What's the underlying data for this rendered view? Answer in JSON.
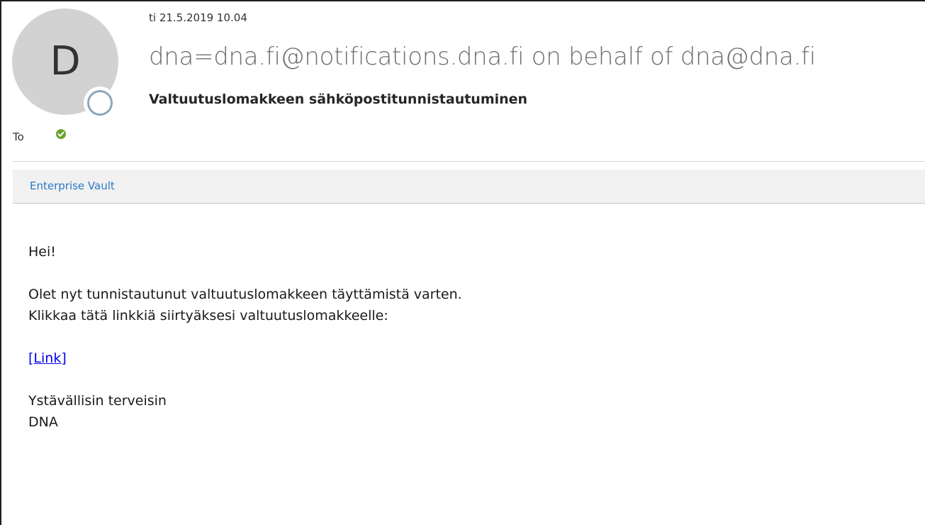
{
  "header": {
    "avatar_initial": "D",
    "date": "ti 21.5.2019 10.04",
    "sender": "dna=dna.fi@notifications.dna.fi on behalf of dna@dna.fi",
    "subject": "Valtuutuslomakkeen sähköpostitunnistautuminen",
    "to_label": "To",
    "recipient_status_icon": "green-check-icon"
  },
  "vault_bar": {
    "label": "Enterprise Vault"
  },
  "message": {
    "greeting": "Hei!",
    "line1": "Olet nyt tunnistautunut valtuutuslomakkeen täyttämistä varten.",
    "line2": "Klikkaa tätä linkkiä siirtyäksesi valtuutuslomakkeelle:",
    "link_text": "[Link]",
    "closing": "Ystävällisin terveisin",
    "signature": "DNA"
  },
  "colors": {
    "link": "#0000ee",
    "vault_link": "#2b78c5",
    "check": "#6aa52d"
  }
}
